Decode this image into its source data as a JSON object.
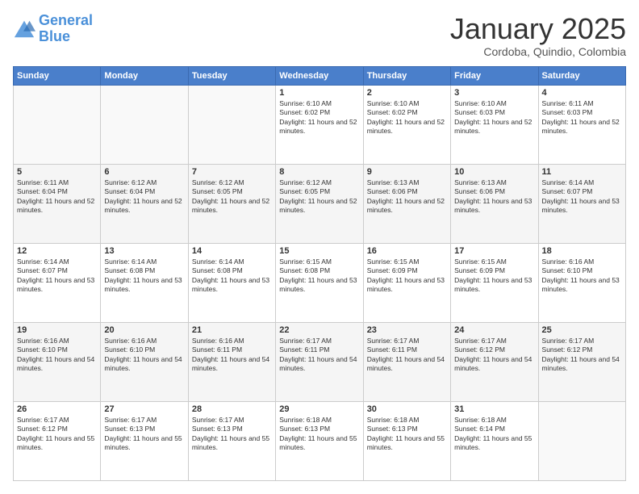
{
  "logo": {
    "line1": "General",
    "line2": "Blue"
  },
  "title": "January 2025",
  "subtitle": "Cordoba, Quindio, Colombia",
  "days_of_week": [
    "Sunday",
    "Monday",
    "Tuesday",
    "Wednesday",
    "Thursday",
    "Friday",
    "Saturday"
  ],
  "weeks": [
    [
      {
        "day": "",
        "sunrise": "",
        "sunset": "",
        "daylight": ""
      },
      {
        "day": "",
        "sunrise": "",
        "sunset": "",
        "daylight": ""
      },
      {
        "day": "",
        "sunrise": "",
        "sunset": "",
        "daylight": ""
      },
      {
        "day": "1",
        "sunrise": "Sunrise: 6:10 AM",
        "sunset": "Sunset: 6:02 PM",
        "daylight": "Daylight: 11 hours and 52 minutes."
      },
      {
        "day": "2",
        "sunrise": "Sunrise: 6:10 AM",
        "sunset": "Sunset: 6:02 PM",
        "daylight": "Daylight: 11 hours and 52 minutes."
      },
      {
        "day": "3",
        "sunrise": "Sunrise: 6:10 AM",
        "sunset": "Sunset: 6:03 PM",
        "daylight": "Daylight: 11 hours and 52 minutes."
      },
      {
        "day": "4",
        "sunrise": "Sunrise: 6:11 AM",
        "sunset": "Sunset: 6:03 PM",
        "daylight": "Daylight: 11 hours and 52 minutes."
      }
    ],
    [
      {
        "day": "5",
        "sunrise": "Sunrise: 6:11 AM",
        "sunset": "Sunset: 6:04 PM",
        "daylight": "Daylight: 11 hours and 52 minutes."
      },
      {
        "day": "6",
        "sunrise": "Sunrise: 6:12 AM",
        "sunset": "Sunset: 6:04 PM",
        "daylight": "Daylight: 11 hours and 52 minutes."
      },
      {
        "day": "7",
        "sunrise": "Sunrise: 6:12 AM",
        "sunset": "Sunset: 6:05 PM",
        "daylight": "Daylight: 11 hours and 52 minutes."
      },
      {
        "day": "8",
        "sunrise": "Sunrise: 6:12 AM",
        "sunset": "Sunset: 6:05 PM",
        "daylight": "Daylight: 11 hours and 52 minutes."
      },
      {
        "day": "9",
        "sunrise": "Sunrise: 6:13 AM",
        "sunset": "Sunset: 6:06 PM",
        "daylight": "Daylight: 11 hours and 52 minutes."
      },
      {
        "day": "10",
        "sunrise": "Sunrise: 6:13 AM",
        "sunset": "Sunset: 6:06 PM",
        "daylight": "Daylight: 11 hours and 53 minutes."
      },
      {
        "day": "11",
        "sunrise": "Sunrise: 6:14 AM",
        "sunset": "Sunset: 6:07 PM",
        "daylight": "Daylight: 11 hours and 53 minutes."
      }
    ],
    [
      {
        "day": "12",
        "sunrise": "Sunrise: 6:14 AM",
        "sunset": "Sunset: 6:07 PM",
        "daylight": "Daylight: 11 hours and 53 minutes."
      },
      {
        "day": "13",
        "sunrise": "Sunrise: 6:14 AM",
        "sunset": "Sunset: 6:08 PM",
        "daylight": "Daylight: 11 hours and 53 minutes."
      },
      {
        "day": "14",
        "sunrise": "Sunrise: 6:14 AM",
        "sunset": "Sunset: 6:08 PM",
        "daylight": "Daylight: 11 hours and 53 minutes."
      },
      {
        "day": "15",
        "sunrise": "Sunrise: 6:15 AM",
        "sunset": "Sunset: 6:08 PM",
        "daylight": "Daylight: 11 hours and 53 minutes."
      },
      {
        "day": "16",
        "sunrise": "Sunrise: 6:15 AM",
        "sunset": "Sunset: 6:09 PM",
        "daylight": "Daylight: 11 hours and 53 minutes."
      },
      {
        "day": "17",
        "sunrise": "Sunrise: 6:15 AM",
        "sunset": "Sunset: 6:09 PM",
        "daylight": "Daylight: 11 hours and 53 minutes."
      },
      {
        "day": "18",
        "sunrise": "Sunrise: 6:16 AM",
        "sunset": "Sunset: 6:10 PM",
        "daylight": "Daylight: 11 hours and 53 minutes."
      }
    ],
    [
      {
        "day": "19",
        "sunrise": "Sunrise: 6:16 AM",
        "sunset": "Sunset: 6:10 PM",
        "daylight": "Daylight: 11 hours and 54 minutes."
      },
      {
        "day": "20",
        "sunrise": "Sunrise: 6:16 AM",
        "sunset": "Sunset: 6:10 PM",
        "daylight": "Daylight: 11 hours and 54 minutes."
      },
      {
        "day": "21",
        "sunrise": "Sunrise: 6:16 AM",
        "sunset": "Sunset: 6:11 PM",
        "daylight": "Daylight: 11 hours and 54 minutes."
      },
      {
        "day": "22",
        "sunrise": "Sunrise: 6:17 AM",
        "sunset": "Sunset: 6:11 PM",
        "daylight": "Daylight: 11 hours and 54 minutes."
      },
      {
        "day": "23",
        "sunrise": "Sunrise: 6:17 AM",
        "sunset": "Sunset: 6:11 PM",
        "daylight": "Daylight: 11 hours and 54 minutes."
      },
      {
        "day": "24",
        "sunrise": "Sunrise: 6:17 AM",
        "sunset": "Sunset: 6:12 PM",
        "daylight": "Daylight: 11 hours and 54 minutes."
      },
      {
        "day": "25",
        "sunrise": "Sunrise: 6:17 AM",
        "sunset": "Sunset: 6:12 PM",
        "daylight": "Daylight: 11 hours and 54 minutes."
      }
    ],
    [
      {
        "day": "26",
        "sunrise": "Sunrise: 6:17 AM",
        "sunset": "Sunset: 6:12 PM",
        "daylight": "Daylight: 11 hours and 55 minutes."
      },
      {
        "day": "27",
        "sunrise": "Sunrise: 6:17 AM",
        "sunset": "Sunset: 6:13 PM",
        "daylight": "Daylight: 11 hours and 55 minutes."
      },
      {
        "day": "28",
        "sunrise": "Sunrise: 6:17 AM",
        "sunset": "Sunset: 6:13 PM",
        "daylight": "Daylight: 11 hours and 55 minutes."
      },
      {
        "day": "29",
        "sunrise": "Sunrise: 6:18 AM",
        "sunset": "Sunset: 6:13 PM",
        "daylight": "Daylight: 11 hours and 55 minutes."
      },
      {
        "day": "30",
        "sunrise": "Sunrise: 6:18 AM",
        "sunset": "Sunset: 6:13 PM",
        "daylight": "Daylight: 11 hours and 55 minutes."
      },
      {
        "day": "31",
        "sunrise": "Sunrise: 6:18 AM",
        "sunset": "Sunset: 6:14 PM",
        "daylight": "Daylight: 11 hours and 55 minutes."
      },
      {
        "day": "",
        "sunrise": "",
        "sunset": "",
        "daylight": ""
      }
    ]
  ]
}
